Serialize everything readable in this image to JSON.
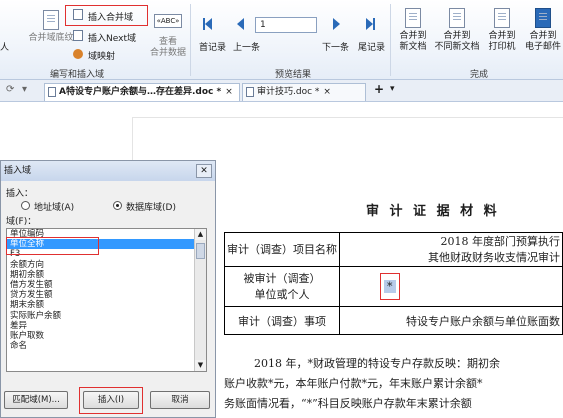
{
  "ribbon": {
    "left_cut_text": "人",
    "merge_field_record_label": "合并域底纹",
    "insert_merge_field_label": "插入合并域",
    "insert_next_field_label": "插入Next域",
    "field_mapping_label": "域映射",
    "view_merged_data_line1": "查看",
    "view_merged_data_line2": "合并数据",
    "abc_label": "«ABC»",
    "first_record_label": "首记录",
    "prev_record_label": "上一条",
    "record_number": "1",
    "next_record_label": "下一条",
    "last_record_label": "尾记录",
    "merge_new_doc_line1": "合并到",
    "merge_new_doc_line2": "新文档",
    "merge_diff_docs_line1": "合并到",
    "merge_diff_docs_line2": "不同新文档",
    "merge_printer_line1": "合并到",
    "merge_printer_line2": "打印机",
    "merge_email_line1": "合并到",
    "merge_email_line2": "电子邮件",
    "group_write_insert": "编写和插入域",
    "group_preview": "预览结果",
    "group_finish": "完成"
  },
  "tabs": [
    {
      "label": "A特设专户账户余额与…存在差异.doc *",
      "active": true
    },
    {
      "label": "审计技巧.doc *",
      "active": false
    }
  ],
  "tab_add": "+",
  "dialog": {
    "title": "插入域",
    "insert_label": "插入：",
    "radio_address": "地址域(A)",
    "radio_database": "数据库域(D)",
    "fields_label": "域(F)：",
    "fields": [
      "单位编码",
      "单位全称",
      "F3",
      "余额方向",
      "期初余额",
      "借方发生额",
      "贷方发生额",
      "期末余额",
      "实际账户余额",
      "差异",
      "账户取数",
      "命名"
    ],
    "selected_index": 1,
    "match_fields_button": "匹配域(M)...",
    "insert_button": "插入(I)",
    "cancel_button": "取消"
  },
  "document": {
    "title": "审 计 证 据 材 料",
    "table": {
      "row1_label": "审计（调查）项目名称",
      "row1_value_line1": "2018 年度部门预算执行",
      "row1_value_line2": "其他财政财务收支情况审计",
      "row2_label_line1": "被审计（调查）",
      "row2_label_line2": "单位或个人",
      "row2_value": "*",
      "row3_label": "审计（调查）事项",
      "row3_value": "特设专户账户余额与单位账面数"
    },
    "para_line1": "2018 年，*财政管理的特设专户存款反映：期初余",
    "para_line2": "账户收款*元，本年账户付款*元，年末账户累计余额*",
    "para_line3": "务账面情况看，“*”科目反映账户存款年末累计余额"
  }
}
